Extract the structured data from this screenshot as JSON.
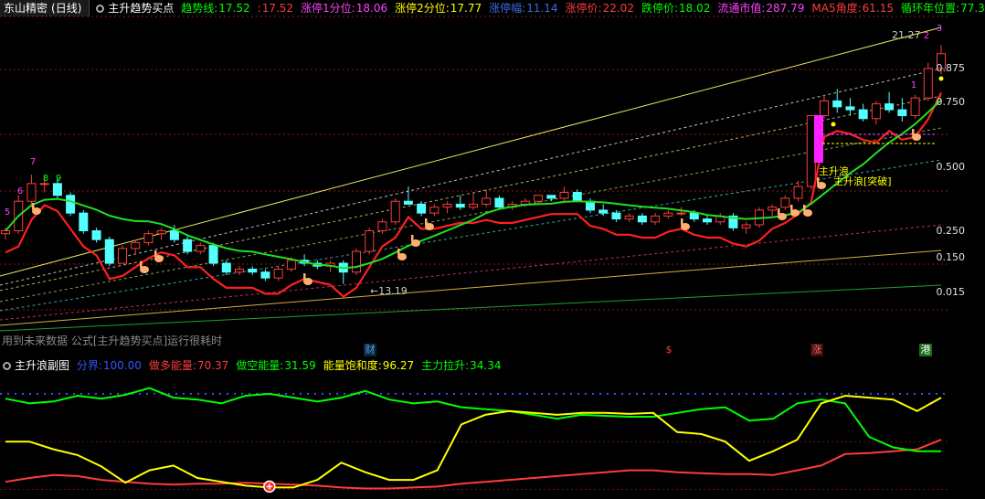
{
  "top_bar": {
    "stock_label": "东山精密",
    "period_label": "(日线)",
    "indicator_name": "主升趋势买点",
    "fields": [
      {
        "label": "趋势线:",
        "value": "17.52",
        "color": "#00ff00"
      },
      {
        "label": ":",
        "value": "17.52",
        "color": "#ff3b3b"
      },
      {
        "label": "涨停1分位:",
        "value": "18.06",
        "color": "#ff40ff"
      },
      {
        "label": "涨停2分位:",
        "value": "17.77",
        "color": "#ffff00"
      },
      {
        "label": "涨停幅:",
        "value": "11.14",
        "color": "#4169e1"
      },
      {
        "label": "涨停价:",
        "value": "22.02",
        "color": "#ff3b3b"
      },
      {
        "label": "跌停价:",
        "value": "18.02",
        "color": "#00ff00"
      },
      {
        "label": "流通市值:",
        "value": "287.79",
        "color": "#ff40ff"
      },
      {
        "label": "MA5角度:",
        "value": "61.15",
        "color": "#ff3b3b"
      },
      {
        "label": "循环年位置:",
        "value": "77.31",
        "color": "#00ff00"
      }
    ]
  },
  "main_chart": {
    "price_labels": [
      "0.875",
      "0.750",
      "0.500",
      "0.250",
      "0.150",
      "0.015"
    ],
    "high_marker": "21.27",
    "low_marker": "13.19",
    "annotation": "主升浪",
    "annotation2": "主升浪[突破]",
    "warning": "用到未来数据 公式[主升趋势买点]运行很耗时",
    "event_tags": [
      {
        "text": "财",
        "color": "#4aa8ff"
      },
      {
        "text": "$",
        "color": "#ff3b3b"
      },
      {
        "text": "涨",
        "color": "#ff6060"
      },
      {
        "text": "港",
        "color": "#ffffff"
      }
    ],
    "number_marks": [
      "5",
      "6",
      "7",
      "8",
      "9",
      "1",
      "2",
      "3"
    ]
  },
  "sub_bar": {
    "indicator_name": "主升浪副图",
    "fields": [
      {
        "label": "分界:",
        "value": "100.00",
        "color": "#3355ff"
      },
      {
        "label": "做多能量:",
        "value": "70.37",
        "color": "#ff3b3b"
      },
      {
        "label": "做空能量:",
        "value": "31.59",
        "color": "#00ff00"
      },
      {
        "label": "能量饱和度:",
        "value": "96.27",
        "color": "#ffff00"
      },
      {
        "label": "主力拉升:",
        "value": "34.34",
        "color": "#00ff00"
      }
    ]
  },
  "chart_data": [
    {
      "type": "candlestick",
      "title": "东山精密 (日线)",
      "high_label": 21.27,
      "low_label": 13.19,
      "candles": [
        [
          14.9,
          15.1,
          14.7,
          15.0
        ],
        [
          15.0,
          16.2,
          14.9,
          16.0
        ],
        [
          16.0,
          16.9,
          15.8,
          16.6
        ],
        [
          16.6,
          16.9,
          16.3,
          16.6
        ],
        [
          16.6,
          16.8,
          16.1,
          16.2
        ],
        [
          16.2,
          16.3,
          15.5,
          15.6
        ],
        [
          15.6,
          15.7,
          14.9,
          15.0
        ],
        [
          15.0,
          15.1,
          14.6,
          14.7
        ],
        [
          14.7,
          14.8,
          13.8,
          13.9
        ],
        [
          13.9,
          14.5,
          13.9,
          14.4
        ],
        [
          14.4,
          14.7,
          14.2,
          14.6
        ],
        [
          14.6,
          15.0,
          14.5,
          14.9
        ],
        [
          14.9,
          15.1,
          14.7,
          15.0
        ],
        [
          15.0,
          15.2,
          14.6,
          14.7
        ],
        [
          14.7,
          14.8,
          14.2,
          14.3
        ],
        [
          14.3,
          14.6,
          14.2,
          14.5
        ],
        [
          14.5,
          14.6,
          13.8,
          13.9
        ],
        [
          13.9,
          14.0,
          13.5,
          13.6
        ],
        [
          13.6,
          13.8,
          13.5,
          13.7
        ],
        [
          13.7,
          13.8,
          13.5,
          13.6
        ],
        [
          13.6,
          13.7,
          13.3,
          13.4
        ],
        [
          13.4,
          13.8,
          13.3,
          13.7
        ],
        [
          13.7,
          14.1,
          13.6,
          14.0
        ],
        [
          14.0,
          14.2,
          13.8,
          13.9
        ],
        [
          13.9,
          14.0,
          13.7,
          13.8
        ],
        [
          13.8,
          14.0,
          13.6,
          13.9
        ],
        [
          13.9,
          14.0,
          13.2,
          13.6
        ],
        [
          13.6,
          14.4,
          13.5,
          14.3
        ],
        [
          14.3,
          15.1,
          14.2,
          15.0
        ],
        [
          15.0,
          15.4,
          14.9,
          15.3
        ],
        [
          15.3,
          16.1,
          15.2,
          16.0
        ],
        [
          16.0,
          16.5,
          15.9,
          15.9
        ],
        [
          15.9,
          16.0,
          15.5,
          15.6
        ],
        [
          15.6,
          15.9,
          15.5,
          15.8
        ],
        [
          15.8,
          16.0,
          15.6,
          15.9
        ],
        [
          15.9,
          16.2,
          15.7,
          15.8
        ],
        [
          15.8,
          16.3,
          15.7,
          15.9
        ],
        [
          15.9,
          16.4,
          15.8,
          16.1
        ],
        [
          16.1,
          16.2,
          15.7,
          15.8
        ],
        [
          15.8,
          16.0,
          15.7,
          15.9
        ],
        [
          15.9,
          16.1,
          15.8,
          16.0
        ],
        [
          16.0,
          16.2,
          15.9,
          16.2
        ],
        [
          16.2,
          16.2,
          16.0,
          16.1
        ],
        [
          16.1,
          16.5,
          16.0,
          16.3
        ],
        [
          16.3,
          16.4,
          16.0,
          16.0
        ],
        [
          16.0,
          16.1,
          15.6,
          15.7
        ],
        [
          15.7,
          15.9,
          15.5,
          15.6
        ],
        [
          15.6,
          15.7,
          15.3,
          15.4
        ],
        [
          15.4,
          15.6,
          15.3,
          15.5
        ],
        [
          15.5,
          15.6,
          15.2,
          15.3
        ],
        [
          15.3,
          15.6,
          15.2,
          15.5
        ],
        [
          15.5,
          15.7,
          15.4,
          15.6
        ],
        [
          15.6,
          15.8,
          15.5,
          15.6
        ],
        [
          15.6,
          15.7,
          15.3,
          15.4
        ],
        [
          15.4,
          15.5,
          15.2,
          15.3
        ],
        [
          15.3,
          15.6,
          15.2,
          15.5
        ],
        [
          15.5,
          15.6,
          15.0,
          15.1
        ],
        [
          15.1,
          15.3,
          14.9,
          15.2
        ],
        [
          15.2,
          15.8,
          15.1,
          15.7
        ],
        [
          15.7,
          15.9,
          15.5,
          15.8
        ],
        [
          15.8,
          16.2,
          15.7,
          16.1
        ],
        [
          16.1,
          16.7,
          16.0,
          16.5
        ],
        [
          16.5,
          17.8,
          16.4,
          18.9
        ],
        [
          18.9,
          19.6,
          18.8,
          19.4
        ],
        [
          19.4,
          19.8,
          19.0,
          19.2
        ],
        [
          19.2,
          19.5,
          18.9,
          19.1
        ],
        [
          19.1,
          19.3,
          18.7,
          18.8
        ],
        [
          18.8,
          19.4,
          18.6,
          19.3
        ],
        [
          19.3,
          19.7,
          19.0,
          19.1
        ],
        [
          19.1,
          19.5,
          18.7,
          18.9
        ],
        [
          18.9,
          19.6,
          18.8,
          19.5
        ],
        [
          19.5,
          20.7,
          19.4,
          20.5
        ],
        [
          20.5,
          21.3,
          20.3,
          21.0
        ]
      ]
    },
    {
      "type": "line",
      "title": "主升浪副图",
      "series": [
        {
          "name": "分界",
          "color": "#3355ff",
          "values": [
            100,
            100,
            100,
            100,
            100,
            100,
            100,
            100,
            100,
            100,
            100,
            100,
            100,
            100,
            100,
            100,
            100,
            100,
            100,
            100,
            100,
            100,
            100,
            100,
            100,
            100,
            100,
            100,
            100,
            100,
            100,
            100,
            100,
            100,
            100,
            100,
            100,
            100,
            100,
            100
          ]
        },
        {
          "name": "做多能量",
          "color": "#ff3b3b",
          "values": [
            8,
            12,
            15,
            14,
            10,
            8,
            6,
            5,
            6,
            6,
            7,
            6,
            5,
            4,
            2,
            1,
            1,
            2,
            3,
            6,
            8,
            10,
            12,
            14,
            16,
            18,
            20,
            20,
            18,
            17,
            16,
            16,
            15,
            20,
            25,
            37,
            38,
            40,
            42,
            52
          ]
        },
        {
          "name": "做空能量",
          "color": "#00ff00",
          "values": [
            95,
            90,
            92,
            98,
            95,
            99,
            106,
            96,
            94,
            90,
            98,
            100,
            96,
            92,
            96,
            103,
            94,
            90,
            92,
            86,
            84,
            82,
            78,
            74,
            78,
            77,
            76,
            76,
            80,
            84,
            86,
            72,
            74,
            90,
            94,
            90,
            55,
            44,
            40,
            40
          ]
        },
        {
          "name": "能量饱和度",
          "color": "#ffff00",
          "values": [
            50,
            50,
            42,
            36,
            24,
            7,
            20,
            25,
            12,
            8,
            4,
            2,
            2,
            10,
            28,
            18,
            10,
            10,
            20,
            68,
            78,
            82,
            80,
            78,
            80,
            80,
            79,
            80,
            60,
            58,
            50,
            30,
            40,
            52,
            90,
            98,
            96,
            94,
            82,
            96
          ]
        }
      ]
    }
  ]
}
